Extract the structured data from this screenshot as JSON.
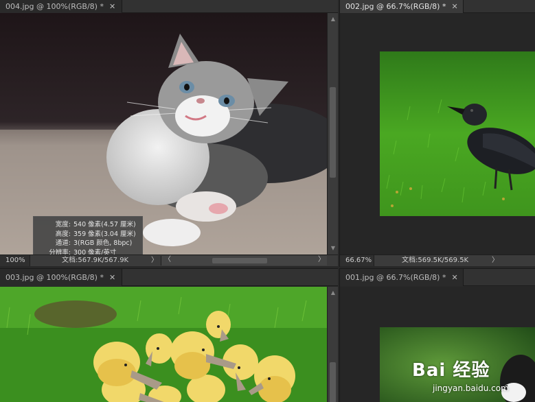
{
  "panes": {
    "topleft": {
      "tab_label": "004.jpg @ 100%(RGB/8) *",
      "zoom": "100%",
      "doc_info": "文档:567.9K/567.9K"
    },
    "topright": {
      "tab_label": "002.jpg @ 66.7%(RGB/8) *",
      "zoom": "66.67%",
      "doc_info": "文档:569.5K/569.5K"
    },
    "bottomleft": {
      "tab_label": "003.jpg @ 100%(RGB/8) *"
    },
    "bottomright": {
      "tab_label": "001.jpg @ 66.7%(RGB/8) *"
    }
  },
  "info_popup": {
    "width_label": "宽度:",
    "width_value": "540 像素(4.57 厘米)",
    "height_label": "高度:",
    "height_value": "359 像素(3.04 厘米)",
    "channels_label": "通道:",
    "channels_value": "3(RGB 颜色, 8bpc)",
    "resolution_label": "分辨率:",
    "resolution_value": "300 像素/英寸"
  },
  "watermark": {
    "brand": "Bai 经验",
    "url": "jingyan.baidu.com"
  },
  "icons": {
    "close": "close-icon",
    "scroll_up": "scroll-up-icon",
    "scroll_down": "scroll-down-icon",
    "scroll_left": "scroll-left-icon",
    "scroll_right": "scroll-right-icon"
  }
}
